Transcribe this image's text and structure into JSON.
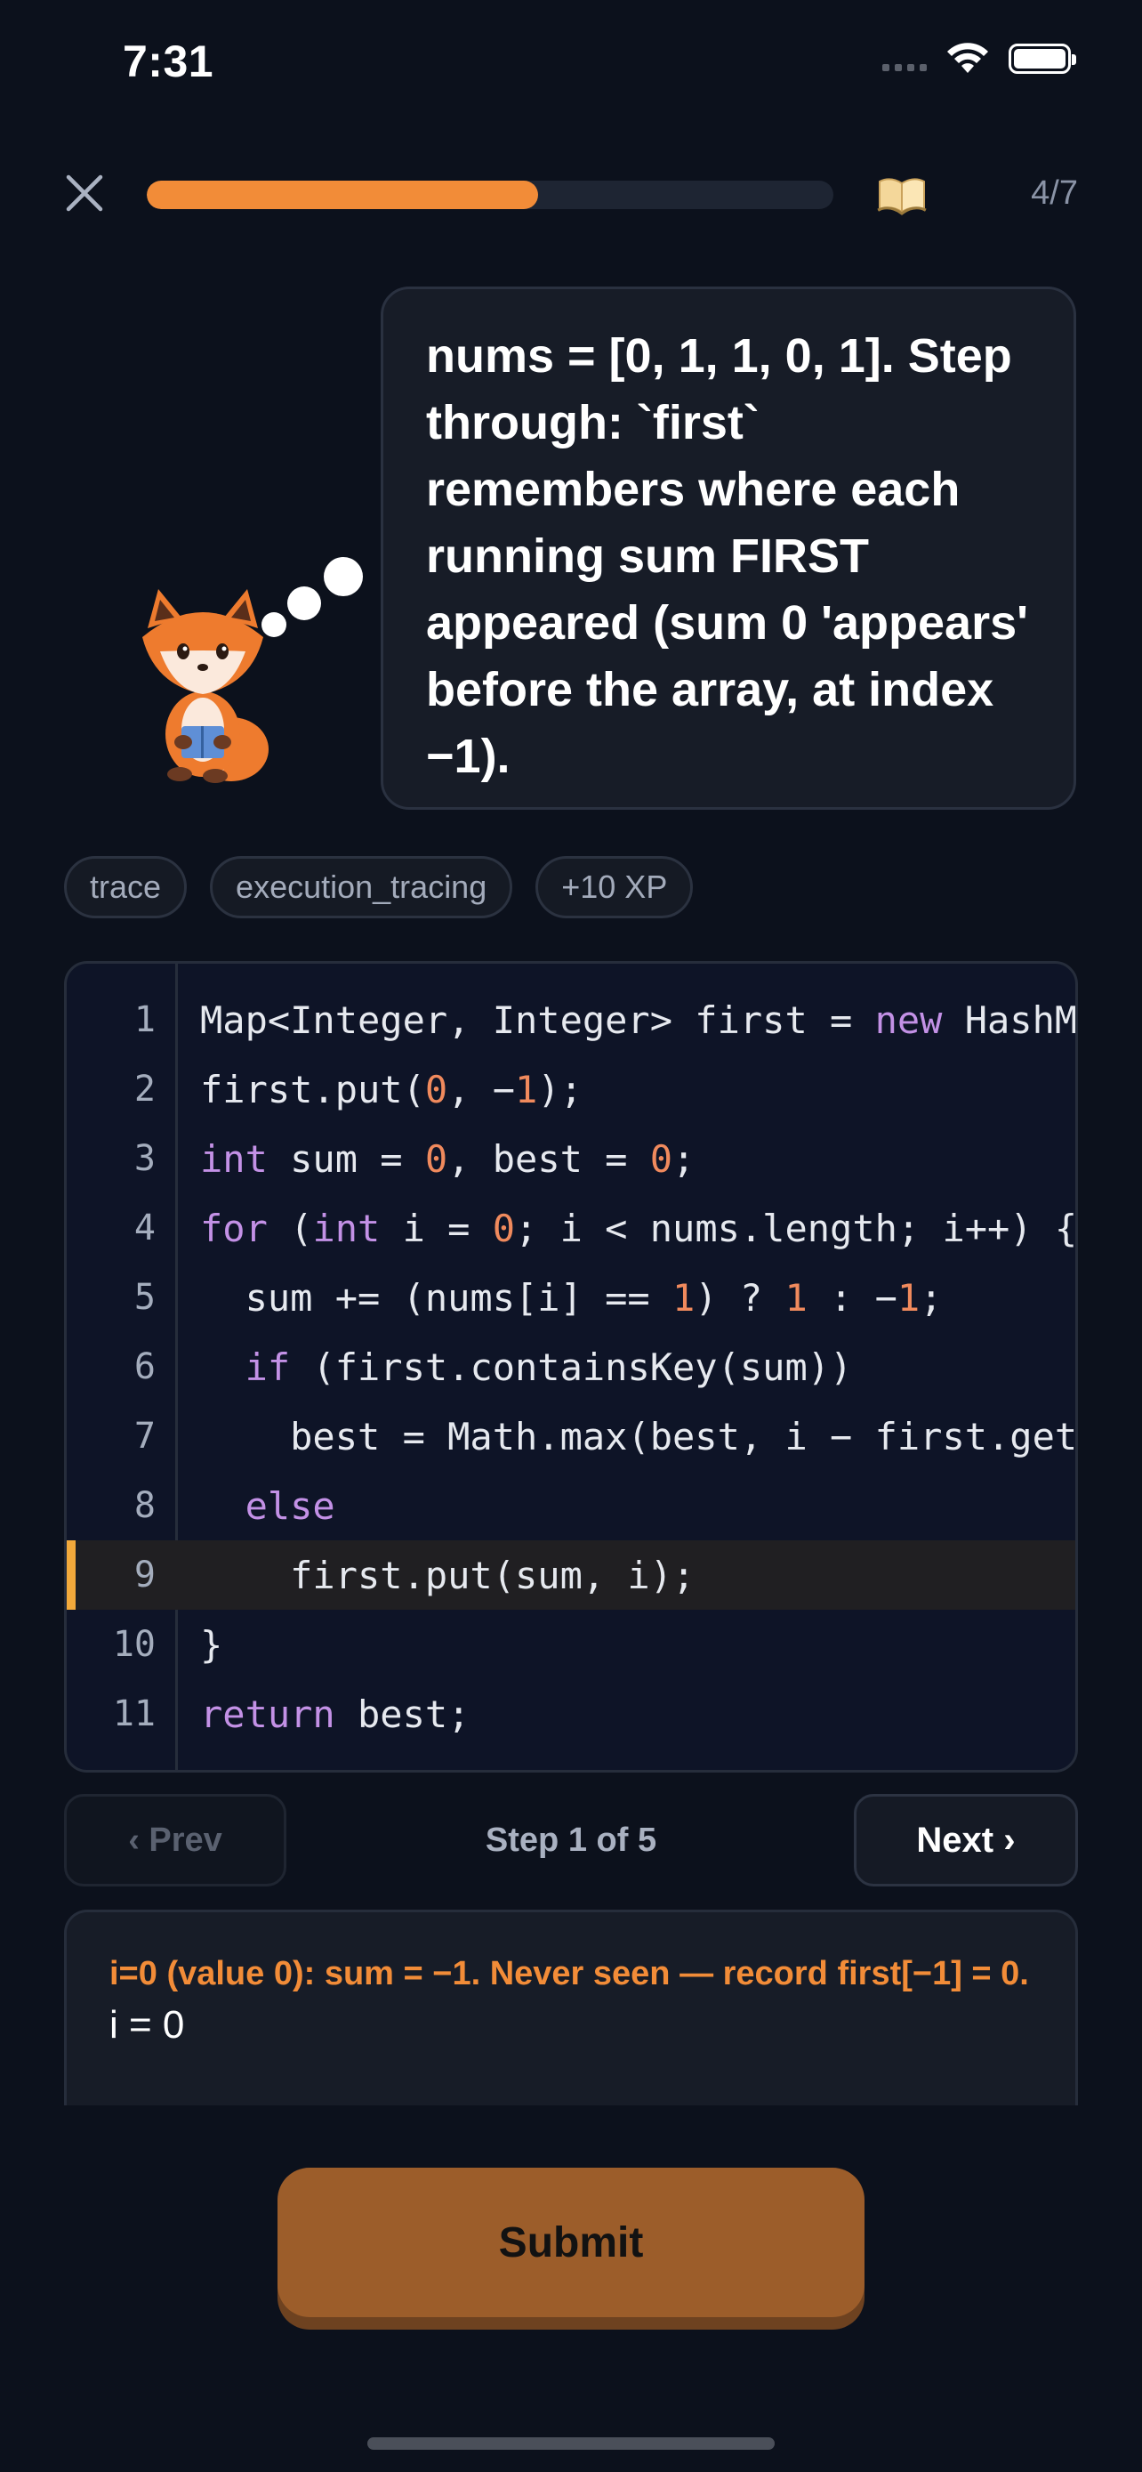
{
  "status_bar": {
    "time": "7:31"
  },
  "header": {
    "progress": 0.57,
    "progress_label": "4/7",
    "book_icon": "open-book-icon",
    "close_icon": "close-icon"
  },
  "bubble": {
    "text": "nums = [0, 1, 1, 0, 1]. Step through: `first` remembers where each running sum FIRST appeared (sum 0 'appears' before the array, at index −1)."
  },
  "tags": [
    "trace",
    "execution_tracing",
    "+10 XP"
  ],
  "code": {
    "highlight_line": 9,
    "lines": [
      [
        [
          "t",
          "Map<Integer, Integer> first = "
        ],
        [
          "k",
          "new"
        ],
        [
          "t",
          " HashMap<>();"
        ]
      ],
      [
        [
          "t",
          "first.put("
        ],
        [
          "n",
          "0"
        ],
        [
          "t",
          ", −"
        ],
        [
          "n",
          "1"
        ],
        [
          "t",
          ");"
        ]
      ],
      [
        [
          "k",
          "int"
        ],
        [
          "t",
          " sum = "
        ],
        [
          "n",
          "0"
        ],
        [
          "t",
          ", best = "
        ],
        [
          "n",
          "0"
        ],
        [
          "t",
          ";"
        ]
      ],
      [
        [
          "k",
          "for"
        ],
        [
          "t",
          " ("
        ],
        [
          "k",
          "int"
        ],
        [
          "t",
          " i = "
        ],
        [
          "n",
          "0"
        ],
        [
          "t",
          "; i < nums.length; i++) {"
        ]
      ],
      [
        [
          "t",
          "  sum += (nums[i] == "
        ],
        [
          "n",
          "1"
        ],
        [
          "t",
          ") ? "
        ],
        [
          "n",
          "1"
        ],
        [
          "t",
          " : −"
        ],
        [
          "n",
          "1"
        ],
        [
          "t",
          ";"
        ]
      ],
      [
        [
          "t",
          "  "
        ],
        [
          "k",
          "if"
        ],
        [
          "t",
          " (first.containsKey(sum))"
        ]
      ],
      [
        [
          "t",
          "    best = Math.max(best, i − first.get(sum));"
        ]
      ],
      [
        [
          "t",
          "  "
        ],
        [
          "k",
          "else"
        ]
      ],
      [
        [
          "t",
          "    first.put(sum, i);"
        ]
      ],
      [
        [
          "t",
          "}"
        ]
      ],
      [
        [
          "k",
          "return"
        ],
        [
          "t",
          " best;"
        ]
      ]
    ]
  },
  "nav": {
    "prev_label": "‹ Prev",
    "step_label": "Step 1 of 5",
    "next_label": "Next ›"
  },
  "explanation": {
    "title": "i=0 (value 0): sum = −1. Never seen — record first[−1] = 0.",
    "variable": "i = 0"
  },
  "submit_label": "Submit",
  "colors": {
    "accent": "#f28c38",
    "keyword": "#c391e6",
    "number": "#f08a5d",
    "highlight_marker": "#f2a93b"
  }
}
